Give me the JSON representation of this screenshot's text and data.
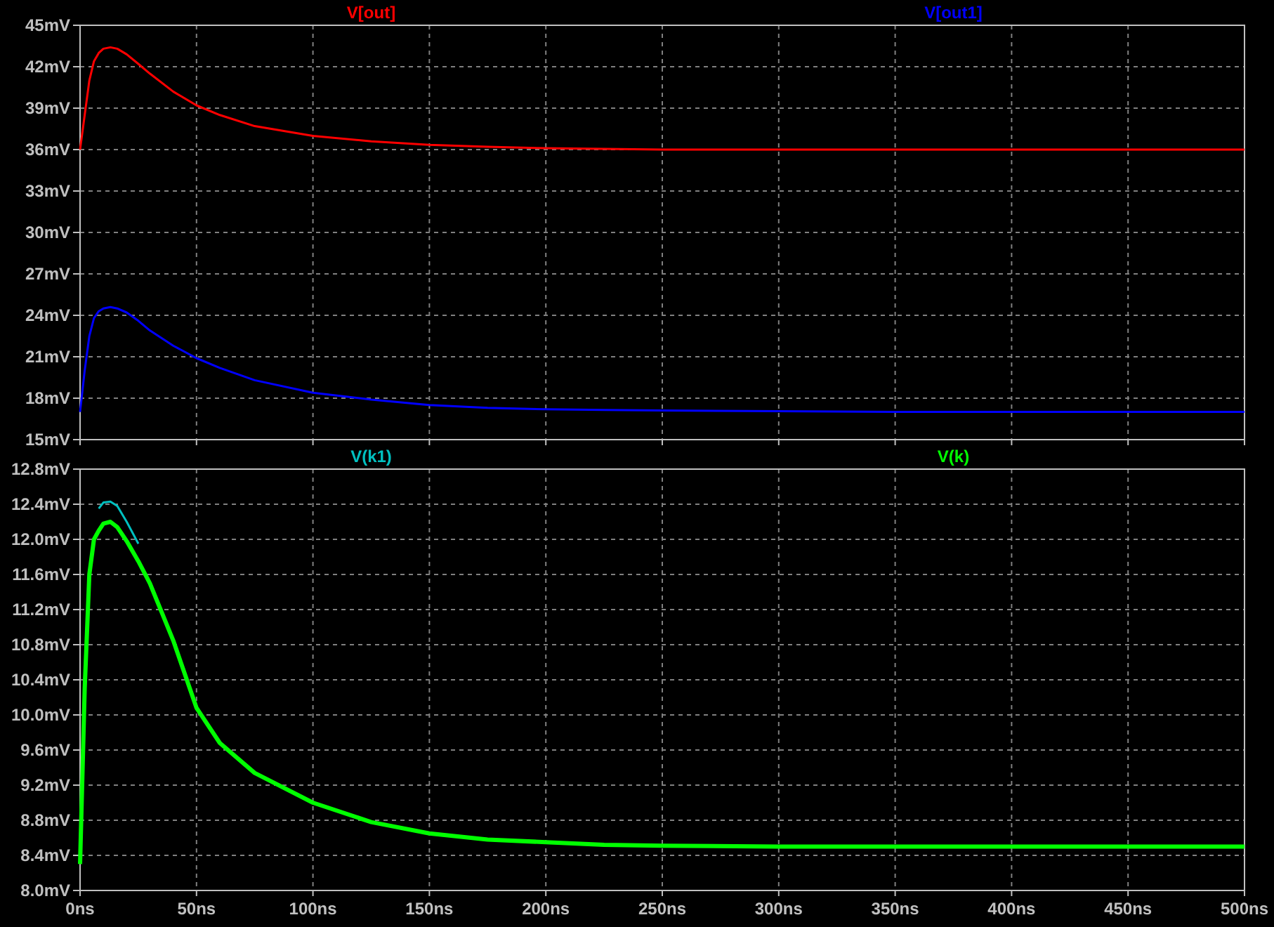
{
  "plots": [
    {
      "chart_data": {
        "type": "line",
        "grid": true,
        "x": [
          0,
          2,
          4,
          6,
          8,
          10,
          13,
          16,
          20,
          25,
          30,
          40,
          50,
          60,
          75,
          100,
          125,
          150,
          175,
          200,
          225,
          250,
          300,
          350,
          400,
          450,
          500
        ],
        "xlim": [
          0,
          500
        ],
        "ylim": [
          15,
          45
        ],
        "yticks": [
          {
            "value": 45,
            "label": "45mV"
          },
          {
            "value": 42,
            "label": "42mV"
          },
          {
            "value": 39,
            "label": "39mV"
          },
          {
            "value": 36,
            "label": "36mV"
          },
          {
            "value": 33,
            "label": "33mV"
          },
          {
            "value": 30,
            "label": "30mV"
          },
          {
            "value": 27,
            "label": "27mV"
          },
          {
            "value": 24,
            "label": "24mV"
          },
          {
            "value": 21,
            "label": "21mV"
          },
          {
            "value": 18,
            "label": "18mV"
          },
          {
            "value": 15,
            "label": "15mV"
          }
        ],
        "series": [
          {
            "name": "V[out]",
            "color": "#ff0000",
            "values": [
              36,
              38.5,
              41,
              42.4,
              43.0,
              43.3,
              43.4,
              43.3,
              42.9,
              42.2,
              41.5,
              40.2,
              39.2,
              38.5,
              37.7,
              37.0,
              36.6,
              36.35,
              36.2,
              36.1,
              36.05,
              36.0,
              36.0,
              36.0,
              36.0,
              36.0,
              36.0
            ]
          },
          {
            "name": "V[out1]",
            "color": "#0000ff",
            "values": [
              17,
              20,
              22.5,
              23.8,
              24.3,
              24.5,
              24.6,
              24.5,
              24.2,
              23.6,
              22.9,
              21.8,
              20.9,
              20.2,
              19.3,
              18.4,
              17.9,
              17.5,
              17.3,
              17.2,
              17.15,
              17.1,
              17.05,
              17.0,
              17.0,
              17.0,
              17.0
            ]
          }
        ]
      }
    },
    {
      "chart_data": {
        "type": "line",
        "grid": true,
        "x": [
          0,
          2,
          4,
          6,
          8,
          10,
          13,
          16,
          20,
          25,
          30,
          40,
          50,
          60,
          75,
          100,
          125,
          150,
          175,
          200,
          225,
          250,
          300,
          350,
          400,
          450,
          500
        ],
        "xlim": [
          0,
          500
        ],
        "ylim": [
          8.0,
          12.8
        ],
        "xticks": [
          {
            "value": 0,
            "label": "0ns"
          },
          {
            "value": 50,
            "label": "50ns"
          },
          {
            "value": 100,
            "label": "100ns"
          },
          {
            "value": 150,
            "label": "150ns"
          },
          {
            "value": 200,
            "label": "200ns"
          },
          {
            "value": 250,
            "label": "250ns"
          },
          {
            "value": 300,
            "label": "300ns"
          },
          {
            "value": 350,
            "label": "350ns"
          },
          {
            "value": 400,
            "label": "400ns"
          },
          {
            "value": 450,
            "label": "450ns"
          },
          {
            "value": 500,
            "label": "500ns"
          }
        ],
        "yticks": [
          {
            "value": 12.8,
            "label": "12.8mV"
          },
          {
            "value": 12.4,
            "label": "12.4mV"
          },
          {
            "value": 12.0,
            "label": "12.0mV"
          },
          {
            "value": 11.6,
            "label": "11.6mV"
          },
          {
            "value": 11.2,
            "label": "11.2mV"
          },
          {
            "value": 10.8,
            "label": "10.8mV"
          },
          {
            "value": 10.4,
            "label": "10.4mV"
          },
          {
            "value": 10.0,
            "label": "10.0mV"
          },
          {
            "value": 9.6,
            "label": "9.6mV"
          },
          {
            "value": 9.2,
            "label": "9.2mV"
          },
          {
            "value": 8.8,
            "label": "8.8mV"
          },
          {
            "value": 8.4,
            "label": "8.4mV"
          },
          {
            "value": 8.0,
            "label": "8.0mV"
          }
        ],
        "series": [
          {
            "name": "V(k1)",
            "color": "#00c0c0",
            "values": [
              null,
              null,
              null,
              null,
              12.35,
              12.42,
              12.43,
              12.38,
              12.2,
              11.95,
              null,
              null,
              null,
              null,
              null,
              null,
              null,
              null,
              null,
              null,
              null,
              null,
              null,
              null,
              null,
              null,
              null
            ]
          },
          {
            "name": "V(k)",
            "color": "#00ff00",
            "values": [
              8.3,
              10.3,
              11.6,
              12.0,
              12.1,
              12.18,
              12.2,
              12.14,
              11.98,
              11.75,
              11.5,
              10.85,
              10.08,
              9.68,
              9.34,
              9.0,
              8.78,
              8.65,
              8.58,
              8.55,
              8.52,
              8.51,
              8.5,
              8.5,
              8.5,
              8.5,
              8.5
            ]
          }
        ]
      }
    }
  ]
}
